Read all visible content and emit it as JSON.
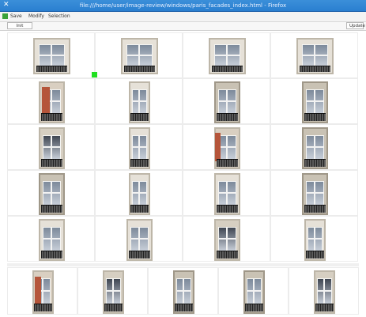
{
  "window": {
    "title": "file:///home/user/image-review/windows/paris_facades_index.html - Firefox"
  },
  "menu": {
    "items": [
      "Save",
      "Modify",
      "Selection"
    ]
  },
  "toolbar": {
    "left_button": "Init",
    "right_button": "Update"
  },
  "colors": {
    "titlebar": "#2a7fd0",
    "marker": "#20e020",
    "wall_light": "#e6e1d8",
    "wall_stone": "#c9c2b4",
    "frame_white": "#f4f4f2",
    "glass": "#7d8a9b",
    "glass_dark": "#3f4652",
    "shutter_red": "#b5553a"
  },
  "grid": {
    "rows": [
      [
        {
          "style": "wide"
        },
        {
          "style": "wide"
        },
        {
          "style": "wide"
        },
        {
          "style": "wide"
        }
      ],
      [
        {
          "style": "red-shutter"
        },
        {
          "style": "tall-narrow"
        },
        {
          "style": "stone"
        },
        {
          "style": "stone"
        }
      ],
      [
        {
          "style": "dark"
        },
        {
          "style": "tall-narrow"
        },
        {
          "style": "red-shutter-open"
        },
        {
          "style": "stone"
        }
      ],
      [
        {
          "style": "stone"
        },
        {
          "style": "tall-narrow"
        },
        {
          "style": "standard"
        },
        {
          "style": "stone"
        }
      ],
      [
        {
          "style": "standard"
        },
        {
          "style": "standard"
        },
        {
          "style": "dark"
        },
        {
          "style": "tall-narrow"
        }
      ]
    ],
    "bottom_row": [
      {
        "style": "red-shutter"
      },
      {
        "style": "dark"
      },
      {
        "style": "stone"
      },
      {
        "style": "stone"
      },
      {
        "style": "dark"
      }
    ],
    "selection_marker": {
      "row": 1,
      "col": 1
    }
  }
}
